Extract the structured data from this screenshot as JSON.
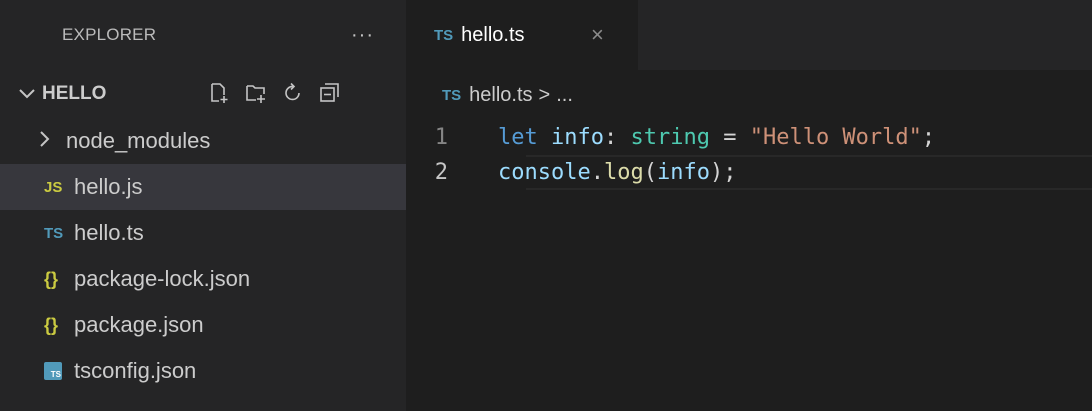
{
  "sidebar": {
    "title": "EXPLORER",
    "more": "···",
    "folder": "HELLO",
    "files": [
      {
        "label": "node_modules",
        "icon": "chevron-right-icon",
        "icon_text": "",
        "kind": "folder",
        "selected": false
      },
      {
        "label": "hello.js",
        "icon": "js-file-icon",
        "icon_text": "JS",
        "kind": "file",
        "selected": true
      },
      {
        "label": "hello.ts",
        "icon": "ts-file-icon",
        "icon_text": "TS",
        "kind": "file",
        "selected": false
      },
      {
        "label": "package-lock.json",
        "icon": "json-file-icon",
        "icon_text": "{}",
        "kind": "file",
        "selected": false
      },
      {
        "label": "package.json",
        "icon": "json-file-icon",
        "icon_text": "{}",
        "kind": "file",
        "selected": false
      },
      {
        "label": "tsconfig.json",
        "icon": "tsconfig-file-icon",
        "icon_text": "TS",
        "kind": "file",
        "selected": false
      }
    ]
  },
  "editor": {
    "tab": {
      "icon_text": "TS",
      "label": "hello.ts",
      "close": "×"
    },
    "breadcrumb": {
      "icon_text": "TS",
      "file": "hello.ts",
      "separator": ">",
      "rest": "..."
    },
    "lines": [
      {
        "number": "1",
        "tokens": [
          {
            "t": "let",
            "c": "kw"
          },
          {
            "t": " ",
            "c": "plain"
          },
          {
            "t": "info",
            "c": "var"
          },
          {
            "t": ": ",
            "c": "plain"
          },
          {
            "t": "string",
            "c": "type"
          },
          {
            "t": " = ",
            "c": "plain"
          },
          {
            "t": "\"Hello World\"",
            "c": "str"
          },
          {
            "t": ";",
            "c": "plain"
          }
        ]
      },
      {
        "number": "2",
        "tokens": [
          {
            "t": "console",
            "c": "var"
          },
          {
            "t": ".",
            "c": "plain"
          },
          {
            "t": "log",
            "c": "fn"
          },
          {
            "t": "(",
            "c": "plain"
          },
          {
            "t": "info",
            "c": "var"
          },
          {
            "t": ");",
            "c": "plain"
          }
        ]
      }
    ]
  },
  "colors": {
    "sidebar_bg": "#252526",
    "editor_bg": "#1e1e1e",
    "selected_bg": "#37373d",
    "ts_blue": "#519aba",
    "json_yellow": "#cbcb41"
  }
}
